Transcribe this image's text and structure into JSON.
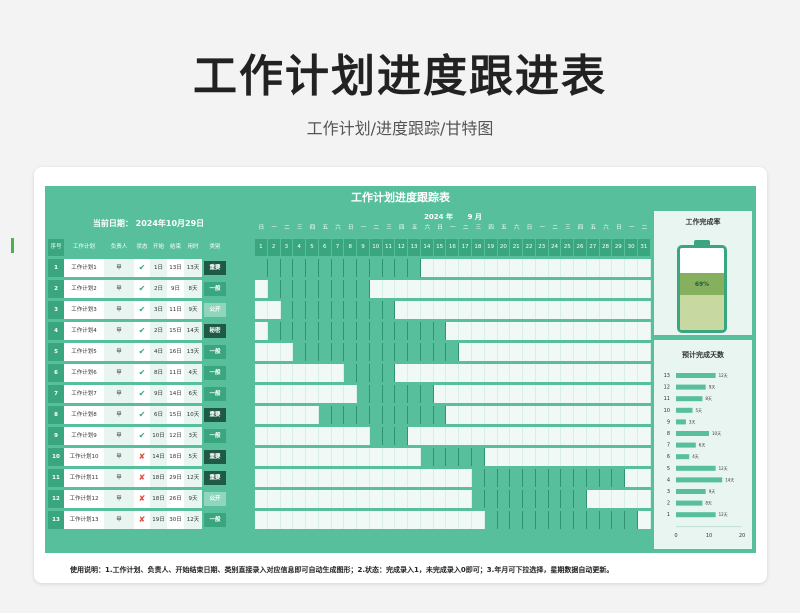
{
  "hero": {
    "title": "工作计划进度跟进表",
    "subtitle": "工作计划/进度跟踪/甘特图"
  },
  "sheet": {
    "title": "工作计划进度跟踪表",
    "date_label": "当前日期：",
    "date_value": "2024年10月29日",
    "headers": [
      "序号",
      "工作计划",
      "负责人",
      "状态",
      "开始",
      "结束",
      "用时",
      "类别"
    ],
    "year": "2024",
    "month": "9",
    "year_unit": "年",
    "month_unit": "月",
    "weekdays": [
      "日",
      "一",
      "二",
      "三",
      "四",
      "五",
      "六",
      "日",
      "一",
      "二",
      "三",
      "四",
      "五",
      "六",
      "日",
      "一",
      "二",
      "三",
      "四",
      "五",
      "六",
      "日",
      "一",
      "二",
      "三",
      "四",
      "五",
      "六",
      "日",
      "一",
      "二"
    ],
    "days": [
      "1",
      "2",
      "3",
      "4",
      "5",
      "6",
      "7",
      "8",
      "9",
      "10",
      "11",
      "12",
      "13",
      "14",
      "15",
      "16",
      "17",
      "18",
      "19",
      "20",
      "21",
      "22",
      "23",
      "24",
      "25",
      "26",
      "27",
      "28",
      "29",
      "30",
      "31"
    ],
    "tasks": [
      {
        "idx": "1",
        "name": "工作计划1",
        "owner": "甲",
        "status": "✔",
        "start": "1日",
        "end": "13日",
        "days": "13天",
        "cat": "重要"
      },
      {
        "idx": "2",
        "name": "工作计划2",
        "owner": "甲",
        "status": "✔",
        "start": "2日",
        "end": "9日",
        "days": "8天",
        "cat": "一般"
      },
      {
        "idx": "3",
        "name": "工作计划3",
        "owner": "甲",
        "status": "✔",
        "start": "3日",
        "end": "11日",
        "days": "9天",
        "cat": "公开"
      },
      {
        "idx": "4",
        "name": "工作计划4",
        "owner": "甲",
        "status": "✔",
        "start": "2日",
        "end": "15日",
        "days": "14天",
        "cat": "秘密"
      },
      {
        "idx": "5",
        "name": "工作计划5",
        "owner": "甲",
        "status": "✔",
        "start": "4日",
        "end": "16日",
        "days": "13天",
        "cat": "一般"
      },
      {
        "idx": "6",
        "name": "工作计划6",
        "owner": "甲",
        "status": "✔",
        "start": "8日",
        "end": "11日",
        "days": "4天",
        "cat": "一般"
      },
      {
        "idx": "7",
        "name": "工作计划7",
        "owner": "甲",
        "status": "✔",
        "start": "9日",
        "end": "14日",
        "days": "6天",
        "cat": "一般"
      },
      {
        "idx": "8",
        "name": "工作计划8",
        "owner": "甲",
        "status": "✔",
        "start": "6日",
        "end": "15日",
        "days": "10天",
        "cat": "重要"
      },
      {
        "idx": "9",
        "name": "工作计划9",
        "owner": "甲",
        "status": "✔",
        "start": "10日",
        "end": "12日",
        "days": "3天",
        "cat": "一般"
      },
      {
        "idx": "10",
        "name": "工作计划10",
        "owner": "甲",
        "status": "✘",
        "start": "14日",
        "end": "18日",
        "days": "5天",
        "cat": "重要"
      },
      {
        "idx": "11",
        "name": "工作计划11",
        "owner": "甲",
        "status": "✘",
        "start": "18日",
        "end": "29日",
        "days": "12天",
        "cat": "重要"
      },
      {
        "idx": "12",
        "name": "工作计划12",
        "owner": "甲",
        "status": "✘",
        "start": "18日",
        "end": "26日",
        "days": "9天",
        "cat": "公开"
      },
      {
        "idx": "13",
        "name": "工作计划13",
        "owner": "甲",
        "status": "✘",
        "start": "19日",
        "end": "30日",
        "days": "12天",
        "cat": "一般"
      }
    ]
  },
  "completion": {
    "title": "工作完成率",
    "percent_label": "69%",
    "value": 0.69
  },
  "chart_data": {
    "type": "bar",
    "title": "预计完成天数",
    "categories": [
      "13",
      "12",
      "11",
      "10",
      "9",
      "8",
      "7",
      "6",
      "5",
      "4",
      "3",
      "2",
      "1"
    ],
    "values": [
      12,
      9,
      8,
      5,
      3,
      10,
      6,
      4,
      12,
      14,
      9,
      8,
      12
    ],
    "value_labels": [
      "12天",
      "9天",
      "8天",
      "5天",
      "3天",
      "10天",
      "6天",
      "4天",
      "12天",
      "14天",
      "9天",
      "8天",
      "12天"
    ],
    "xticks": [
      "0",
      "10",
      "20"
    ],
    "xlim": [
      0,
      20
    ]
  },
  "notes": "使用说明：1.工作计划、负责人、开始结束日期、类别直接录入对应信息即可自动生成图形；2.状态：完成录入1，未完成录入0即可；3.年月可下拉选择，星期数据自动更新。",
  "colors": {
    "primary": "#57bf9c",
    "dark": "#3aa67f",
    "bar": "#57bf9c",
    "cat_dark": "#1f5a46",
    "light_cat": "#8fd6bd",
    "done": "#3aa67f",
    "undone": "#d94e3c"
  }
}
